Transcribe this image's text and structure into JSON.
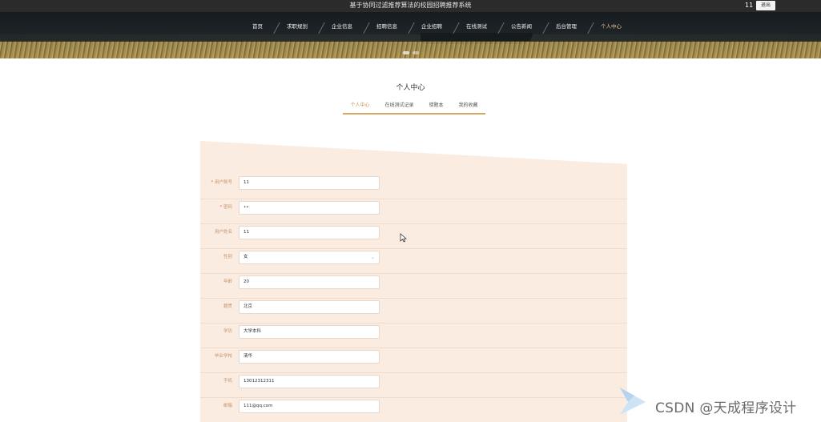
{
  "app": {
    "title": "基于协同过滤推荐算法的校园招聘推荐系统",
    "username": "11",
    "logout_label": "退出"
  },
  "nav": {
    "items": [
      "首页",
      "求职规划",
      "企业信息",
      "招聘信息",
      "企业招聘",
      "在线测试",
      "公告新闻",
      "后台管理",
      "个人中心"
    ],
    "active_index": 8
  },
  "page": {
    "title": "个人中心",
    "tabs": [
      "个人中心",
      "在线测试记录",
      "错题本",
      "我的收藏"
    ],
    "active_tab": 0
  },
  "form": {
    "fields": [
      {
        "label": "用户账号",
        "required": true,
        "value": "11"
      },
      {
        "label": "密码",
        "required": true,
        "value": "••"
      },
      {
        "label": "用户姓名",
        "required": false,
        "value": "11"
      },
      {
        "label": "性别",
        "required": false,
        "value": "女",
        "type": "select"
      },
      {
        "label": "年龄",
        "required": false,
        "value": "20"
      },
      {
        "label": "籍贯",
        "required": false,
        "value": "北京"
      },
      {
        "label": "学历",
        "required": false,
        "value": "大学本科"
      },
      {
        "label": "毕业学校",
        "required": false,
        "value": "清华"
      },
      {
        "label": "手机",
        "required": false,
        "value": "13012312311"
      },
      {
        "label": "邮箱",
        "required": false,
        "value": "111@qq.com"
      }
    ]
  },
  "watermark": {
    "text": "CSDN @天成程序设计"
  },
  "colors": {
    "accent": "#d8a564",
    "panel_bg": "#faece1",
    "label": "#c8946a"
  }
}
